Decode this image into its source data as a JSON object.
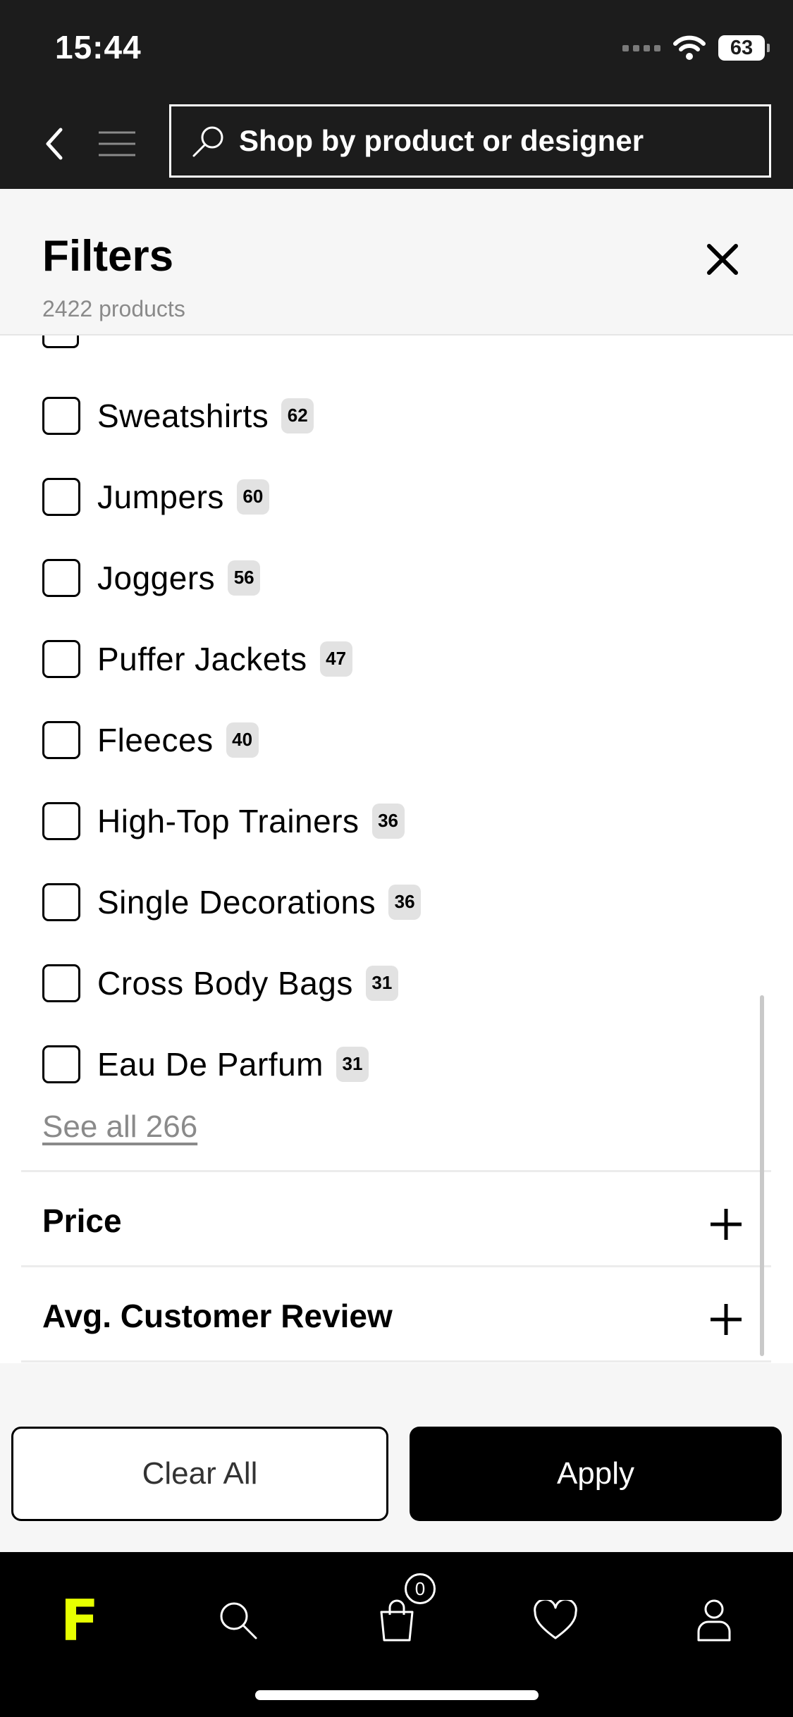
{
  "status_bar": {
    "time": "15:44",
    "battery": "63"
  },
  "header": {
    "search_placeholder": "Shop by product or designer"
  },
  "filters": {
    "title": "Filters",
    "product_count": "2422 products",
    "options": [
      {
        "label": "Sweatshirts",
        "count": "62"
      },
      {
        "label": "Jumpers",
        "count": "60"
      },
      {
        "label": "Joggers",
        "count": "56"
      },
      {
        "label": "Puffer Jackets",
        "count": "47"
      },
      {
        "label": "Fleeces",
        "count": "40"
      },
      {
        "label": "High-Top Trainers",
        "count": "36"
      },
      {
        "label": "Single Decorations",
        "count": "36"
      },
      {
        "label": "Cross Body Bags",
        "count": "31"
      },
      {
        "label": "Eau De Parfum",
        "count": "31"
      }
    ],
    "see_all": "See all 266",
    "sections": [
      {
        "title": "Price"
      },
      {
        "title": "Avg. Customer Review"
      }
    ]
  },
  "actions": {
    "clear_label": "Clear All",
    "apply_label": "Apply"
  },
  "tab_bar": {
    "logo": "F",
    "cart_count": "0"
  },
  "colors": {
    "brand_accent": "#e6ff00",
    "header_bg": "#1c1c1c"
  },
  "icons": [
    "back-icon",
    "menu-icon",
    "search-icon",
    "close-icon",
    "plus-icon",
    "cart-icon",
    "heart-icon",
    "account-icon"
  ]
}
